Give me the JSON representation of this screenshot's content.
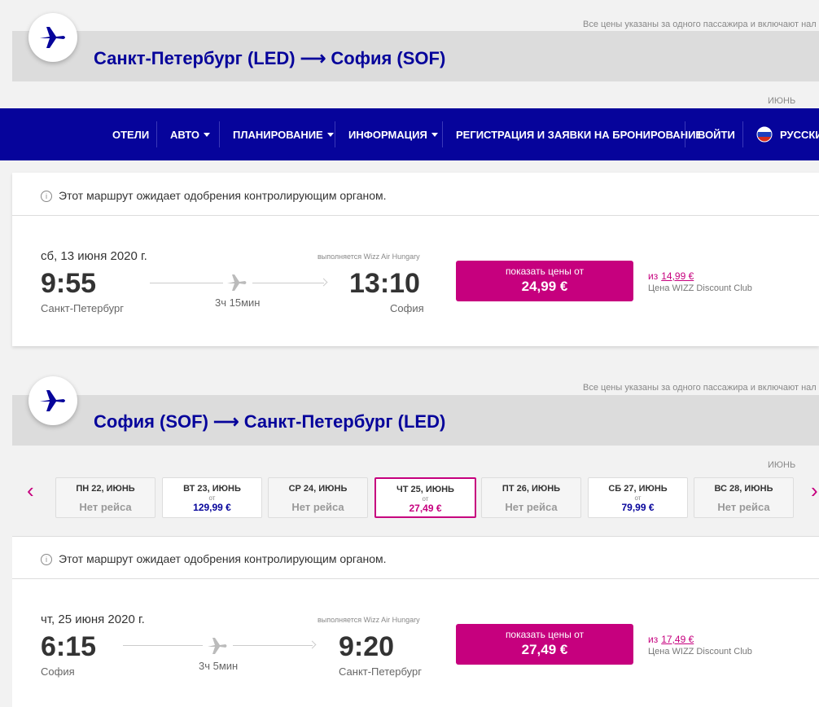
{
  "outbound": {
    "price_note": "Все цены указаны за одного пассажира и включают нал",
    "route_title": "Санкт-Петербург (LED) ⟶ София (SOF)",
    "month_label": "ИЮНЬ"
  },
  "nav": {
    "items": [
      {
        "label": "ОТЕЛИ",
        "dropdown": false
      },
      {
        "label": "АВТО",
        "dropdown": true
      },
      {
        "label": "ПЛАНИРОВАНИЕ",
        "dropdown": true
      },
      {
        "label": "ИНФОРМАЦИЯ",
        "dropdown": true
      },
      {
        "label": "РЕГИСТРАЦИЯ И ЗАЯВКИ НА БРОНИРОВАНИЕ",
        "dropdown": false
      },
      {
        "label": "ВОЙТИ",
        "dropdown": false
      }
    ],
    "language": "РУССКИЙ",
    "colors": {
      "nav_bg": "#06049b",
      "accent": "#c6007e"
    }
  },
  "flight1": {
    "info": "Этот маршрут ожидает одобрения контролирующим органом.",
    "date": "сб, 13 июня 2020 г.",
    "operated_by": "выполняется Wizz Air Hungary",
    "dep_time": "9:55",
    "dep_city": "Санкт-Петербург",
    "duration": "3ч 15мин",
    "arr_time": "13:10",
    "arr_city": "София",
    "btn_label": "показать цены от",
    "btn_price": "24,99 €",
    "club_from": "из",
    "club_price": "14,99 €",
    "club_label": "Цена WIZZ Discount Club"
  },
  "inbound": {
    "price_note": "Все цены указаны за одного пассажира и включают нал",
    "route_title": "София (SOF) ⟶ Санкт-Петербург (LED)",
    "month_label": "ИЮНЬ",
    "days": [
      {
        "label": "ПН 22, ИЮНЬ",
        "none": "Нет рейса",
        "from": "",
        "price": "",
        "selected": false
      },
      {
        "label": "ВТ 23, ИЮНЬ",
        "none": "",
        "from": "от",
        "price": "129,99 €",
        "selected": false
      },
      {
        "label": "СР 24, ИЮНЬ",
        "none": "Нет рейса",
        "from": "",
        "price": "",
        "selected": false
      },
      {
        "label": "ЧТ 25, ИЮНЬ",
        "none": "",
        "from": "от",
        "price": "27,49 €",
        "selected": true
      },
      {
        "label": "ПТ 26, ИЮНЬ",
        "none": "Нет рейса",
        "from": "",
        "price": "",
        "selected": false
      },
      {
        "label": "СБ 27, ИЮНЬ",
        "none": "",
        "from": "от",
        "price": "79,99 €",
        "selected": false
      },
      {
        "label": "ВС 28, ИЮНЬ",
        "none": "Нет рейса",
        "from": "",
        "price": "",
        "selected": false
      }
    ]
  },
  "flight2": {
    "info": "Этот маршрут ожидает одобрения контролирующим органом.",
    "date": "чт, 25 июня 2020 г.",
    "operated_by": "выполняется Wizz Air Hungary",
    "dep_time": "6:15",
    "dep_city": "София",
    "duration": "3ч 5мин",
    "arr_time": "9:20",
    "arr_city": "Санкт-Петербург",
    "btn_label": "показать цены от",
    "btn_price": "27,49 €",
    "club_from": "из",
    "club_price": "17,49 €",
    "club_label": "Цена WIZZ Discount Club"
  }
}
